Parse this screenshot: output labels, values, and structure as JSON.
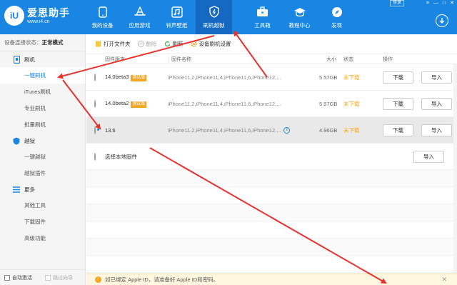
{
  "app": {
    "logo_mark": "iU",
    "title": "爱思助手",
    "url": "www.i4.cn",
    "login_label": "登录",
    "win_controls": [
      "≡",
      "—",
      "□",
      "✕"
    ]
  },
  "nav": [
    {
      "label": "我的设备",
      "icon": "phone-icon"
    },
    {
      "label": "应用游戏",
      "icon": "appstore-icon"
    },
    {
      "label": "铃声壁纸",
      "icon": "music-icon"
    },
    {
      "label": "刷机越狱",
      "icon": "flash-icon",
      "active": true
    },
    {
      "label": "工具箱",
      "icon": "toolbox-icon"
    },
    {
      "label": "教程中心",
      "icon": "graduation-icon"
    },
    {
      "label": "发现",
      "icon": "compass-icon"
    }
  ],
  "sidebar": {
    "status_label": "设备连接状态：",
    "status_value": "正常模式",
    "section_flash": "刷机",
    "item_oneclick": "一键刷机",
    "item_itunes": "iTunes刷机",
    "item_pro": "专业刷机",
    "item_batch": "批量刷机",
    "section_jailbreak": "越狱",
    "item_jb_oneclick": "一键越狱",
    "item_jb_plugin": "越狱插件",
    "section_more": "更多",
    "item_tools": "其他工具",
    "item_download": "下载固件",
    "item_advanced": "高级功能",
    "auto_activate": "自动激活",
    "skip_guide": "跳过向导"
  },
  "toolbar": {
    "open_folder": "打开文件夹",
    "delete": "删除",
    "refresh": "刷新",
    "device_settings": "设备刷机设置"
  },
  "table": {
    "headers": {
      "version": "固件版本",
      "model": "固件名称",
      "size": "大小",
      "status": "状态",
      "ops": "操作"
    },
    "rows": [
      {
        "version": "14.0beta3",
        "tag": "测试版",
        "models": "iPhone11,2,iPhone11,4,iPhone11,6,iPhone12,...",
        "size": "5.57GB",
        "status": "未下载",
        "btn1": "下载",
        "btn2": "导入"
      },
      {
        "version": "14.0beta2",
        "tag": "测试版",
        "models": "iPhone11,2,iPhone11,4,iPhone11,6,iPhone12,...",
        "size": "5.57GB",
        "status": "未下载",
        "btn1": "下载",
        "btn2": "导入"
      },
      {
        "version": "13.6",
        "tag": "",
        "models": "iPhone11,2,iPhone11,4,iPhone11,6,iPhone12,...",
        "size": "4.96GB",
        "status": "未下载",
        "btn1": "下载",
        "btn2": "导入",
        "selected": true
      }
    ],
    "local": {
      "label": "选择本地固件",
      "btn": "导入"
    }
  },
  "notice": {
    "text": "如已绑定 Apple ID，请准备好 Apple ID和密码。",
    "close": "✕"
  },
  "colors": {
    "brand": "#1a86e4",
    "brand_dark": "#1468c2",
    "warning": "#f5a623",
    "arrow": "#e8322c"
  }
}
